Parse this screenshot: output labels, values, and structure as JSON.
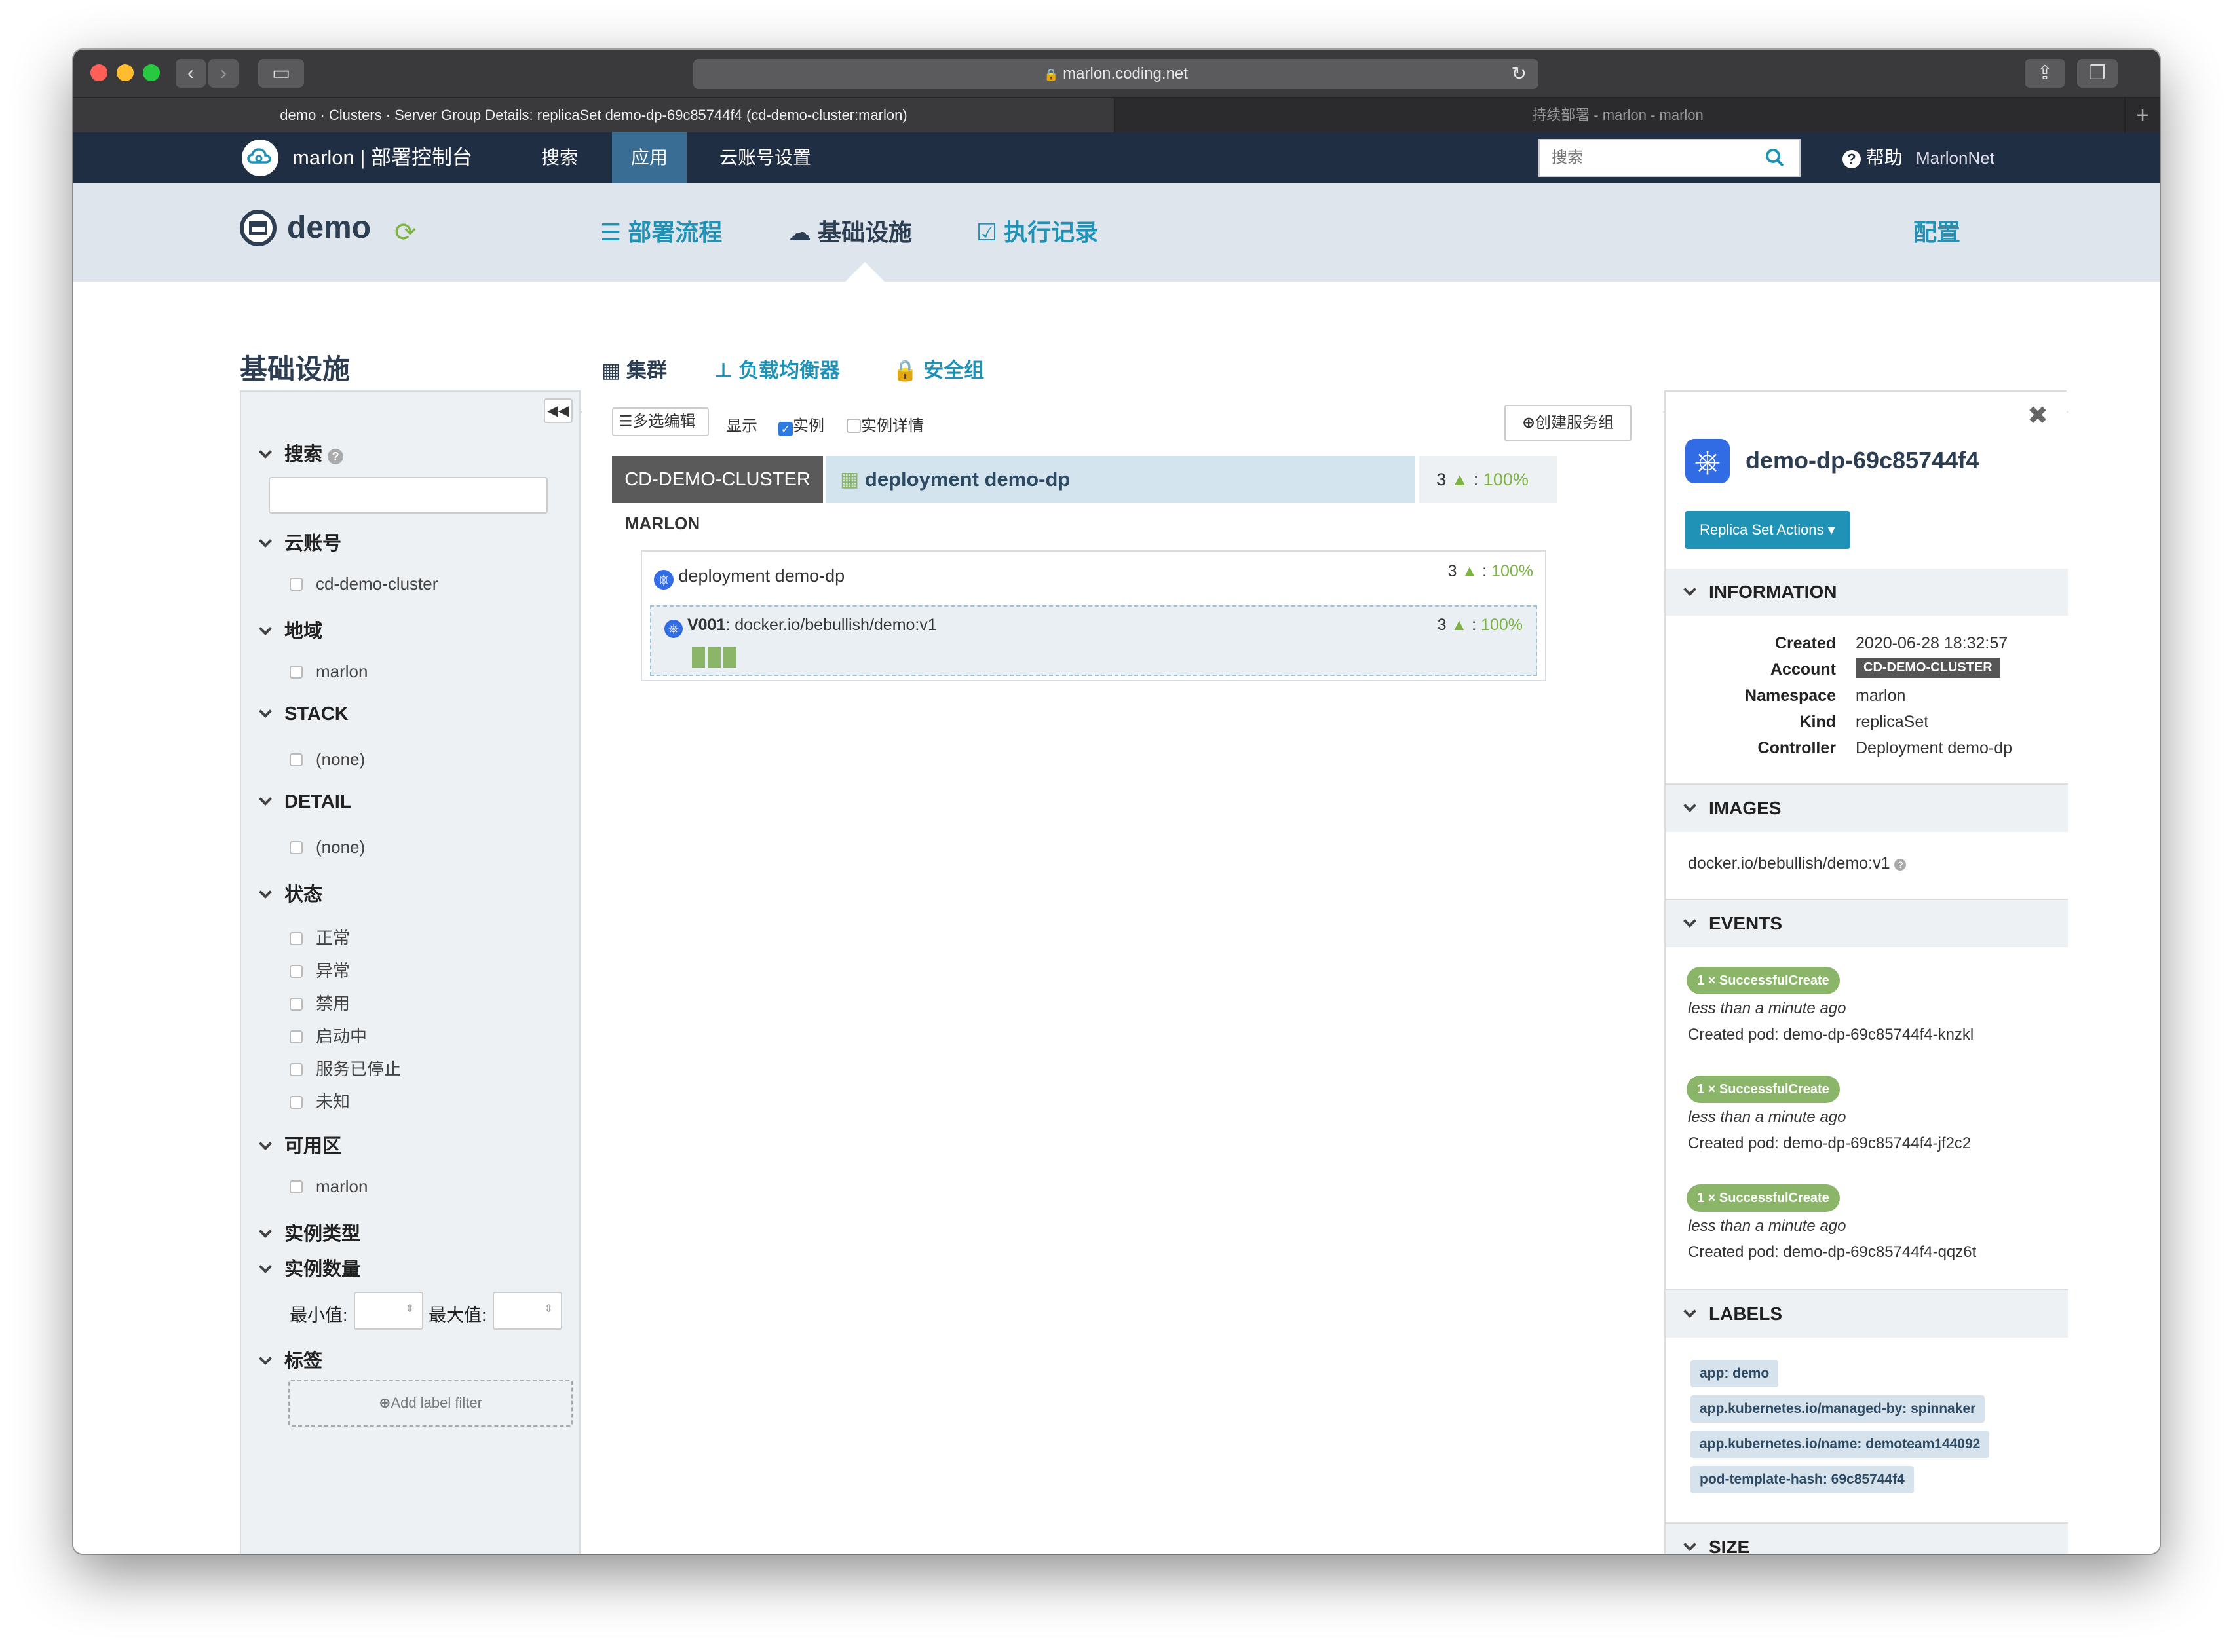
{
  "browser": {
    "url": "marlon.coding.net",
    "tab_active": "demo · Clusters · Server Group Details: replicaSet demo-dp-69c85744f4 (cd-demo-cluster:marlon)",
    "tab_inactive": "持续部署 - marlon - marlon",
    "new_tab": "+"
  },
  "nav": {
    "brand": "marlon | 部署控制台",
    "items": [
      "搜索",
      "应用",
      "云账号设置"
    ],
    "search_placeholder": "搜索",
    "help": "帮助",
    "user": "MarlonNet"
  },
  "app": {
    "name": "demo",
    "tabs": [
      "部署流程",
      "基础设施",
      "执行记录"
    ],
    "config": "配置"
  },
  "infra": {
    "title": "基础设施",
    "subtabs": [
      "集群",
      "负载均衡器",
      "安全组"
    ]
  },
  "filters": {
    "search_label": "搜索",
    "account_label": "云账号",
    "account_opts": [
      "cd-demo-cluster"
    ],
    "region_label": "地域",
    "region_opts": [
      "marlon"
    ],
    "stack_label": "STACK",
    "stack_opts": [
      "(none)"
    ],
    "detail_label": "DETAIL",
    "detail_opts": [
      "(none)"
    ],
    "status_label": "状态",
    "status_opts": [
      "正常",
      "异常",
      "禁用",
      "启动中",
      "服务已停止",
      "未知"
    ],
    "az_label": "可用区",
    "az_opts": [
      "marlon"
    ],
    "instance_type_label": "实例类型",
    "instance_count_label": "实例数量",
    "min_label": "最小值:",
    "max_label": "最大值:",
    "tags_label": "标签",
    "add_label_filter": "Add label filter"
  },
  "toolbar": {
    "multi_edit": "多选编辑",
    "show": "显示",
    "instances": "实例",
    "instance_details": "实例详情",
    "create_group": "创建服务组",
    "instances_checked": true,
    "details_checked": false
  },
  "cluster": {
    "account": "CD-DEMO-CLUSTER",
    "name": "deployment demo-dp",
    "count": "3",
    "pct": "100%",
    "region": "MARLON",
    "deployment": "deployment demo-dp",
    "dep_count": "3",
    "dep_pct": "100%",
    "version": "V001",
    "image": "docker.io/bebullish/demo:v1",
    "sg_count": "3",
    "sg_pct": "100%",
    "instances": 3
  },
  "detail": {
    "title": "demo-dp-69c85744f4",
    "actions": "Replica Set Actions",
    "info_label": "INFORMATION",
    "info": [
      {
        "k": "Created",
        "v": "2020-06-28 18:32:57"
      },
      {
        "k": "Account",
        "v": "CD-DEMO-CLUSTER"
      },
      {
        "k": "Namespace",
        "v": "marlon"
      },
      {
        "k": "Kind",
        "v": "replicaSet"
      },
      {
        "k": "Controller",
        "v": "Deployment demo-dp"
      }
    ],
    "images_label": "IMAGES",
    "image": "docker.io/bebullish/demo:v1",
    "events_label": "EVENTS",
    "events": [
      {
        "badge": "1 × SuccessfulCreate",
        "when": "less than a minute ago",
        "msg": "Created pod: demo-dp-69c85744f4-knzkl"
      },
      {
        "badge": "1 × SuccessfulCreate",
        "when": "less than a minute ago",
        "msg": "Created pod: demo-dp-69c85744f4-jf2c2"
      },
      {
        "badge": "1 × SuccessfulCreate",
        "when": "less than a minute ago",
        "msg": "Created pod: demo-dp-69c85744f4-qqz6t"
      }
    ],
    "labels_label": "LABELS",
    "labels": [
      "app: demo",
      "app.kubernetes.io/managed-by: spinnaker",
      "app.kubernetes.io/name: demoteam144092",
      "pod-template-hash: 69c85744f4"
    ],
    "size_label": "SIZE"
  },
  "colors": {
    "nav_bg": "#1f2e43",
    "accent": "#1f92b6",
    "healthy": "#8bb66a",
    "account_badge": "#555555"
  }
}
